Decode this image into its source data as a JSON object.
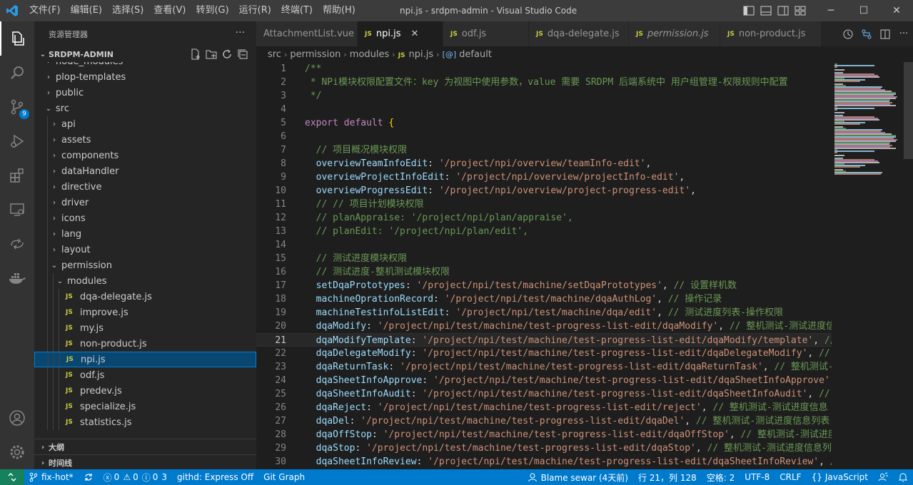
{
  "window": {
    "title": "npi.js - srdpm-admin - Visual Studio Code",
    "menu": [
      "文件(F)",
      "编辑(E)",
      "选择(S)",
      "查看(V)",
      "转到(G)",
      "运行(R)",
      "终端(T)",
      "帮助(H)"
    ],
    "controls": {
      "minimize": "─",
      "maximize": "☐",
      "close": "✕"
    }
  },
  "activity_bar": {
    "items": [
      "explorer-icon",
      "search-icon",
      "source-control-icon",
      "run-debug-icon",
      "extensions-icon",
      "remote-explorer-icon",
      "live-share-icon",
      "docker-icon"
    ],
    "scm_badge": "9",
    "bottom": [
      "account-icon",
      "settings-gear-icon"
    ]
  },
  "sidebar": {
    "title": "资源管理器",
    "more": "···",
    "root": "SRDPM-ADMIN",
    "tree": [
      {
        "label": "node_modules",
        "type": "folder",
        "open": false,
        "depth": 1
      },
      {
        "label": "plop-templates",
        "type": "folder",
        "open": false,
        "depth": 1
      },
      {
        "label": "public",
        "type": "folder",
        "open": false,
        "depth": 1
      },
      {
        "label": "src",
        "type": "folder",
        "open": true,
        "depth": 1
      },
      {
        "label": "api",
        "type": "folder",
        "open": false,
        "depth": 2
      },
      {
        "label": "assets",
        "type": "folder",
        "open": false,
        "depth": 2
      },
      {
        "label": "components",
        "type": "folder",
        "open": false,
        "depth": 2
      },
      {
        "label": "dataHandler",
        "type": "folder",
        "open": false,
        "depth": 2
      },
      {
        "label": "directive",
        "type": "folder",
        "open": false,
        "depth": 2
      },
      {
        "label": "driver",
        "type": "folder",
        "open": false,
        "depth": 2
      },
      {
        "label": "icons",
        "type": "folder",
        "open": false,
        "depth": 2
      },
      {
        "label": "lang",
        "type": "folder",
        "open": false,
        "depth": 2
      },
      {
        "label": "layout",
        "type": "folder",
        "open": false,
        "depth": 2
      },
      {
        "label": "permission",
        "type": "folder",
        "open": true,
        "depth": 2
      },
      {
        "label": "modules",
        "type": "folder",
        "open": true,
        "depth": 3
      },
      {
        "label": "dqa-delegate.js",
        "type": "js",
        "depth": 4
      },
      {
        "label": "improve.js",
        "type": "js",
        "depth": 4
      },
      {
        "label": "my.js",
        "type": "js",
        "depth": 4
      },
      {
        "label": "non-product.js",
        "type": "js",
        "depth": 4
      },
      {
        "label": "npi.js",
        "type": "js",
        "depth": 4,
        "selected": true
      },
      {
        "label": "odf.js",
        "type": "js",
        "depth": 4
      },
      {
        "label": "predev.js",
        "type": "js",
        "depth": 4
      },
      {
        "label": "specialize.js",
        "type": "js",
        "depth": 4
      },
      {
        "label": "statistics.js",
        "type": "js",
        "depth": 4
      }
    ],
    "outline": "大纲",
    "timeline": "时间线"
  },
  "tabs": [
    {
      "label": "AttachmentList.vue",
      "active": false,
      "js": false
    },
    {
      "label": "npi.js",
      "active": true,
      "js": true
    },
    {
      "label": "odf.js",
      "active": false,
      "js": true
    },
    {
      "label": "dqa-delegate.js",
      "active": false,
      "js": true
    },
    {
      "label": "permission.js",
      "active": false,
      "js": true,
      "italic": true
    },
    {
      "label": "non-product.js",
      "active": false,
      "js": true
    }
  ],
  "breadcrumb": [
    "src",
    "permission",
    "modules",
    "npi.js",
    "default"
  ],
  "editor": {
    "current_line": 21,
    "lines": [
      [
        [
          "cm",
          "/**"
        ]
      ],
      [
        [
          "cm",
          " * NPi模块权限配置文件：key 为视图中使用参数，value 需要 SRDPM 后端系统中 用户组管理-权限规则中配置"
        ]
      ],
      [
        [
          "cm",
          " */"
        ]
      ],
      [],
      [
        [
          "kw",
          "export"
        ],
        [
          "pun",
          " "
        ],
        [
          "kw",
          "default"
        ],
        [
          "pun",
          " "
        ],
        [
          "br",
          "{"
        ]
      ],
      [],
      [
        [
          "pun",
          "  "
        ],
        [
          "cm",
          "// 项目概况模块权限"
        ]
      ],
      [
        [
          "pun",
          "  "
        ],
        [
          "key",
          "overviewTeamInfoEdit"
        ],
        [
          "pun",
          ": "
        ],
        [
          "str",
          "'/project/npi/overview/teamInfo-edit'"
        ],
        [
          "pun",
          ","
        ]
      ],
      [
        [
          "pun",
          "  "
        ],
        [
          "key",
          "overviewProjectInfoEdit"
        ],
        [
          "pun",
          ": "
        ],
        [
          "str",
          "'/project/npi/overview/projectInfo-edit'"
        ],
        [
          "pun",
          ","
        ]
      ],
      [
        [
          "pun",
          "  "
        ],
        [
          "key",
          "overviewProgressEdit"
        ],
        [
          "pun",
          ": "
        ],
        [
          "str",
          "'/project/npi/overview/project-progress-edit'"
        ],
        [
          "pun",
          ","
        ]
      ],
      [
        [
          "pun",
          "  "
        ],
        [
          "cm",
          "// // 项目计划模块权限"
        ]
      ],
      [
        [
          "pun",
          "  "
        ],
        [
          "cm",
          "// planAppraise: '/project/npi/plan/appraise',"
        ]
      ],
      [
        [
          "pun",
          "  "
        ],
        [
          "cm",
          "// planEdit: '/project/npi/plan/edit',"
        ]
      ],
      [],
      [
        [
          "pun",
          "  "
        ],
        [
          "cm",
          "// 测试进度模块权限"
        ]
      ],
      [
        [
          "pun",
          "  "
        ],
        [
          "cm",
          "// 测试进度-整机测试模块权限"
        ]
      ],
      [
        [
          "pun",
          "  "
        ],
        [
          "key",
          "setDqaPrototypes"
        ],
        [
          "pun",
          ": "
        ],
        [
          "str",
          "'/project/npi/test/machine/setDqaPrototypes'"
        ],
        [
          "pun",
          ", "
        ],
        [
          "cm",
          "// 设置样机数"
        ]
      ],
      [
        [
          "pun",
          "  "
        ],
        [
          "key",
          "machineOprationRecord"
        ],
        [
          "pun",
          ": "
        ],
        [
          "str",
          "'/project/npi/test/machine/dqaAuthLog'"
        ],
        [
          "pun",
          ", "
        ],
        [
          "cm",
          "// 操作记录"
        ]
      ],
      [
        [
          "pun",
          "  "
        ],
        [
          "key",
          "machineTestinfoListEdit"
        ],
        [
          "pun",
          ": "
        ],
        [
          "str",
          "'/project/npi/test/machine/dqa/edit'"
        ],
        [
          "pun",
          ", "
        ],
        [
          "cm",
          "// 测试进度列表-操作权限"
        ]
      ],
      [
        [
          "pun",
          "  "
        ],
        [
          "key",
          "dqaModify"
        ],
        [
          "pun",
          ": "
        ],
        [
          "str",
          "'/project/npi/test/machine/test-progress-list-edit/dqaModify'"
        ],
        [
          "pun",
          ", "
        ],
        [
          "cm",
          "// 整机测试-测试进度信"
        ]
      ],
      [
        [
          "pun",
          "  "
        ],
        [
          "key",
          "dqaModifyTemplate"
        ],
        [
          "pun",
          ": "
        ],
        [
          "str",
          "'/project/npi/test/machine/test-progress-list-edit/dqaModify/template'"
        ],
        [
          "pun",
          ", "
        ],
        [
          "cm",
          "//"
        ]
      ],
      [
        [
          "pun",
          "  "
        ],
        [
          "key",
          "dqaDelegateModify"
        ],
        [
          "pun",
          ": "
        ],
        [
          "str",
          "'/project/npi/test/machine/test-progress-list-edit/dqaDelegateModify'"
        ],
        [
          "pun",
          ", "
        ],
        [
          "cm",
          "// 整"
        ]
      ],
      [
        [
          "pun",
          "  "
        ],
        [
          "key",
          "dqaReturnTask"
        ],
        [
          "pun",
          ": "
        ],
        [
          "str",
          "'/project/npi/test/machine/test-progress-list-edit/dqaReturnTask'"
        ],
        [
          "pun",
          ", "
        ],
        [
          "cm",
          "// 整机测试-"
        ]
      ],
      [
        [
          "pun",
          "  "
        ],
        [
          "key",
          "dqaSheetInfoApprove"
        ],
        [
          "pun",
          ": "
        ],
        [
          "str",
          "'/project/npi/test/machine/test-progress-list-edit/dqaSheetInfoApprove'"
        ],
        [
          "pun",
          ", "
        ],
        [
          "cm",
          "//"
        ]
      ],
      [
        [
          "pun",
          "  "
        ],
        [
          "key",
          "dqaSheetInfoAudit"
        ],
        [
          "pun",
          ": "
        ],
        [
          "str",
          "'/project/npi/test/machine/test-progress-list-edit/dqaSheetInfoAudit'"
        ],
        [
          "pun",
          ", "
        ],
        [
          "cm",
          "// 整"
        ]
      ],
      [
        [
          "pun",
          "  "
        ],
        [
          "key",
          "dqaReject"
        ],
        [
          "pun",
          ": "
        ],
        [
          "str",
          "'/project/npi/test/machine/test-progress-list-edit/reject'"
        ],
        [
          "pun",
          ", "
        ],
        [
          "cm",
          "// 整机测试-测试进度信息"
        ]
      ],
      [
        [
          "pun",
          "  "
        ],
        [
          "key",
          "dqaDel"
        ],
        [
          "pun",
          ": "
        ],
        [
          "str",
          "'/project/npi/test/machine/test-progress-list-edit/dqaDel'"
        ],
        [
          "pun",
          ", "
        ],
        [
          "cm",
          "// 整机测试-测试进度信息列表"
        ]
      ],
      [
        [
          "pun",
          "  "
        ],
        [
          "key",
          "dqaOffStop"
        ],
        [
          "pun",
          ": "
        ],
        [
          "str",
          "'/project/npi/test/machine/test-progress-list-edit/dqaOffStop'"
        ],
        [
          "pun",
          ", "
        ],
        [
          "cm",
          "// 整机测试-测试进度"
        ]
      ],
      [
        [
          "pun",
          "  "
        ],
        [
          "key",
          "dqaStop"
        ],
        [
          "pun",
          ": "
        ],
        [
          "str",
          "'/project/npi/test/machine/test-progress-list-edit/dqaStop'"
        ],
        [
          "pun",
          ", "
        ],
        [
          "cm",
          "// 整机测试-测试进度信息列"
        ]
      ],
      [
        [
          "pun",
          "  "
        ],
        [
          "key",
          "dqaSheetInfoReview"
        ],
        [
          "pun",
          ": "
        ],
        [
          "str",
          "'/project/npi/test/machine/test-progress-list-edit/dqaSheetInfoReview'"
        ],
        [
          "pun",
          ", "
        ],
        [
          "cm",
          "/"
        ]
      ]
    ]
  },
  "status_bar": {
    "branch": "fix-hot*",
    "errors": "0",
    "warnings": "0",
    "info": "0",
    "infos": "3",
    "githd": "githd: Express Off",
    "git_graph": "Git Graph",
    "blame": "Blame sewar (4天前)",
    "position": "行 21，列 128",
    "spaces": "空格: 2",
    "encoding": "UTF-8",
    "eol": "CRLF",
    "language": "JavaScript"
  },
  "colors": {
    "accent": "#007acc",
    "remote": "#16825d",
    "selection": "#094771"
  }
}
